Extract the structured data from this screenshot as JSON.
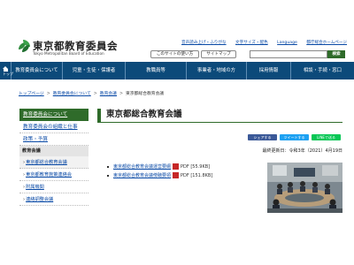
{
  "header": {
    "logo_title": "東京都教育委員会",
    "logo_subtitle": "Tokyo Metropolitan Board of Education",
    "utility_links": [
      "音声読み上げ・ふりがな",
      "文字サイズ・配色",
      "Language",
      "都庁総合ホームページ"
    ],
    "pill_usage": "このサイトの使い方",
    "pill_sitemap": "サイトマップ",
    "search_placeholder": "",
    "search_button": "検索"
  },
  "nav": {
    "home": "トップ",
    "items": [
      "教育委員会について",
      "児童・生徒・保護者",
      "教職員等",
      "事業者・地域の方",
      "採用情報",
      "相談・手続・窓口"
    ]
  },
  "breadcrumb": {
    "items": [
      "トップページ",
      "教育委員会について",
      "教育会議",
      "東京都総合教育会議"
    ]
  },
  "sidebar": {
    "heading": "教育委員会について",
    "items": [
      "教育委員会の組織と仕事",
      "政策・予算"
    ],
    "section": "教育会議",
    "sub_items": [
      "東京都総合教育会議",
      "東京都教育施策連絡会",
      "附属機関",
      "連絡調整会議"
    ]
  },
  "main": {
    "title": "東京都総合教育会議",
    "share": {
      "facebook": "シェアする",
      "twitter": "ツイートする",
      "line": "LINEで送る"
    },
    "updated": "最終更新日：令和3年（2021）4月19日",
    "documents": [
      {
        "label": "東京都総合教育会議運営要綱",
        "format": "PDF",
        "size": "[55.9KB]"
      },
      {
        "label": "東京都総合教育会議傍聴要領",
        "format": "PDF",
        "size": "[151.8KB]"
      }
    ]
  },
  "colors": {
    "nav_bg": "#0c4a7a",
    "accent_green": "#2f6b2a",
    "link": "#0a4aa6"
  }
}
